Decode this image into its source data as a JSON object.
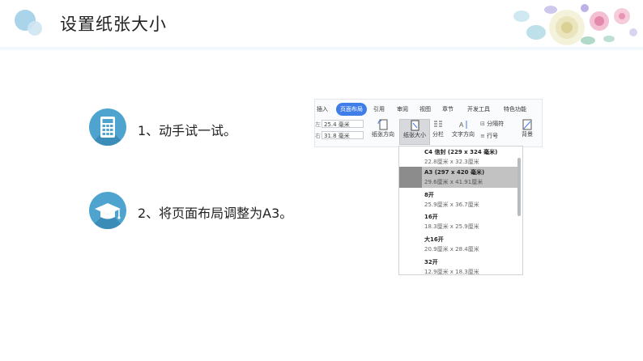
{
  "slide": {
    "title": "设置纸张大小"
  },
  "steps": [
    {
      "text": "1、动手试一试。",
      "icon": "calculator-icon"
    },
    {
      "text": "2、将页面布局调整为A3。",
      "icon": "graduation-cap-icon"
    }
  ],
  "ribbon": {
    "tabs": [
      "插入",
      "页面布局",
      "引用",
      "审阅",
      "视图",
      "章节",
      "开发工具",
      "特色功能"
    ],
    "active_tab": "页面布局",
    "margins": [
      {
        "side": "左",
        "value": "25.4 毫米"
      },
      {
        "side": "右",
        "value": "31.8 毫米"
      }
    ],
    "buttons": {
      "orientation": "纸张方向",
      "size": "纸张大小",
      "columns": "分栏",
      "text_direction": "文字方向",
      "separator": "分隔符",
      "line_number": "行号",
      "background": "背景"
    }
  },
  "paper_sizes": [
    {
      "name": "C4 信封 (229 x 324 毫米)",
      "size": "22.8厘米 x 32.3厘米",
      "selected": false
    },
    {
      "name": "A3 (297 x 420 毫米)",
      "size": "29.6厘米 x 41.91厘米",
      "selected": true
    },
    {
      "name": "8开",
      "size": "25.9厘米 x 36.7厘米",
      "selected": false
    },
    {
      "name": "16开",
      "size": "18.3厘米 x 25.9厘米",
      "selected": false
    },
    {
      "name": "大16开",
      "size": "20.9厘米 x 28.4厘米",
      "selected": false
    },
    {
      "name": "32开",
      "size": "12.9厘米 x 18.3厘米",
      "selected": false
    }
  ],
  "colors": {
    "accent": "#4fa4cf",
    "tab_active": "#3f7ee8"
  }
}
